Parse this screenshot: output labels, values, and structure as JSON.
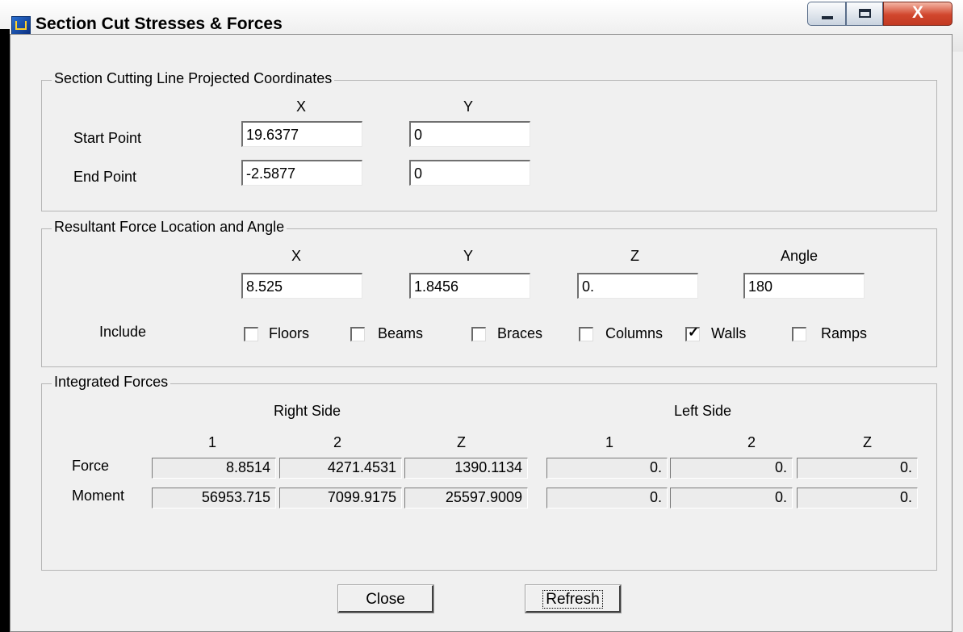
{
  "window": {
    "title": "Section Cut Stresses & Forces",
    "controls": {
      "minimize": "minimize-icon",
      "maximize": "maximize-icon",
      "close_label": "X"
    }
  },
  "cut_line": {
    "title": "Section Cutting Line Projected Coordinates",
    "col_x": "X",
    "col_y": "Y",
    "start_label": "Start Point",
    "end_label": "End Point",
    "start_x": "19.6377",
    "start_y": "0",
    "end_x": "-2.5877",
    "end_y": "0"
  },
  "resultant": {
    "title": "Resultant Force Location and Angle",
    "col_x": "X",
    "col_y": "Y",
    "col_z": "Z",
    "col_angle": "Angle",
    "x": "8.525",
    "y": "1.8456",
    "z": "0.",
    "angle": "180",
    "include_label": "Include",
    "include": [
      {
        "label": "Floors",
        "checked": false
      },
      {
        "label": "Beams",
        "checked": false
      },
      {
        "label": "Braces",
        "checked": false
      },
      {
        "label": "Columns",
        "checked": false
      },
      {
        "label": "Walls",
        "checked": true
      },
      {
        "label": "Ramps",
        "checked": false
      }
    ]
  },
  "forces": {
    "title": "Integrated Forces",
    "right_side": "Right Side",
    "left_side": "Left Side",
    "cols": [
      "1",
      "2",
      "Z",
      "1",
      "2",
      "Z"
    ],
    "rows": [
      {
        "label": "Force",
        "values": [
          "8.8514",
          "4271.4531",
          "1390.1134",
          "0.",
          "0.",
          "0."
        ]
      },
      {
        "label": "Moment",
        "values": [
          "56953.715",
          "7099.9175",
          "25597.9009",
          "0.",
          "0.",
          "0."
        ]
      }
    ]
  },
  "buttons": {
    "close": "Close",
    "refresh": "Refresh"
  }
}
